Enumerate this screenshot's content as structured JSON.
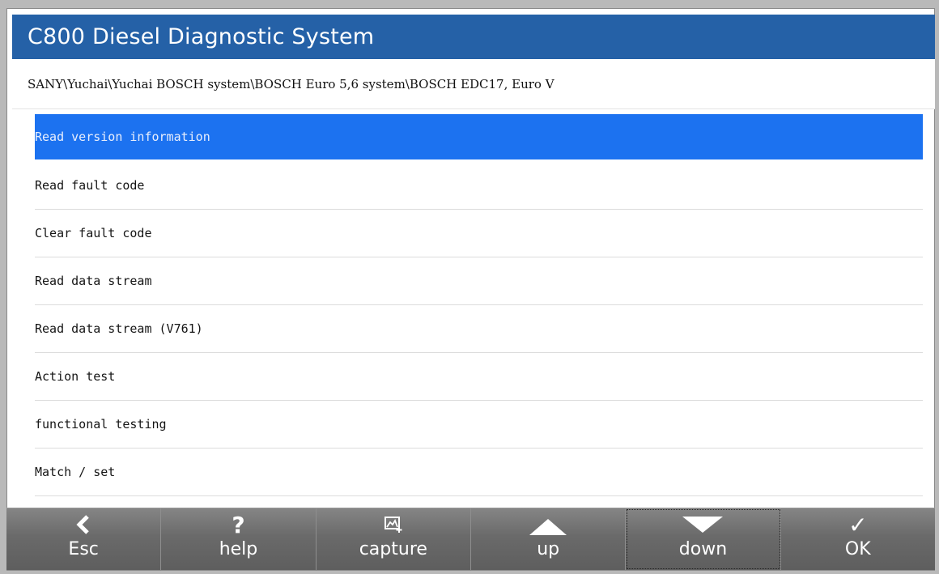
{
  "window": {
    "title": "C800 Diesel Diagnostic System",
    "path": "SANY\\Yuchai\\Yuchai BOSCH system\\BOSCH Euro 5,6 system\\BOSCH EDC17, Euro V"
  },
  "menu": {
    "selected_index": 0,
    "items": [
      {
        "label": "Read version information"
      },
      {
        "label": "Read fault code"
      },
      {
        "label": "Clear fault code"
      },
      {
        "label": "Read data stream"
      },
      {
        "label": "Read data stream (V761)"
      },
      {
        "label": "Action test"
      },
      {
        "label": "functional testing"
      },
      {
        "label": "Match / set"
      }
    ]
  },
  "toolbar": {
    "esc": {
      "label": "Esc",
      "icon": "chevron-left-icon",
      "glyph": "<"
    },
    "help": {
      "label": "help",
      "icon": "question-icon",
      "glyph": "?"
    },
    "capture": {
      "label": "capture",
      "icon": "screenshot-icon"
    },
    "up": {
      "label": "up",
      "icon": "triangle-up-icon"
    },
    "down": {
      "label": "down",
      "icon": "triangle-down-icon"
    },
    "ok": {
      "label": "OK",
      "icon": "checkmark-icon",
      "glyph": "✓"
    }
  },
  "colors": {
    "title_bar": "#2561a7",
    "selection": "#1c72f0",
    "toolbar": "#6a6a6a"
  }
}
